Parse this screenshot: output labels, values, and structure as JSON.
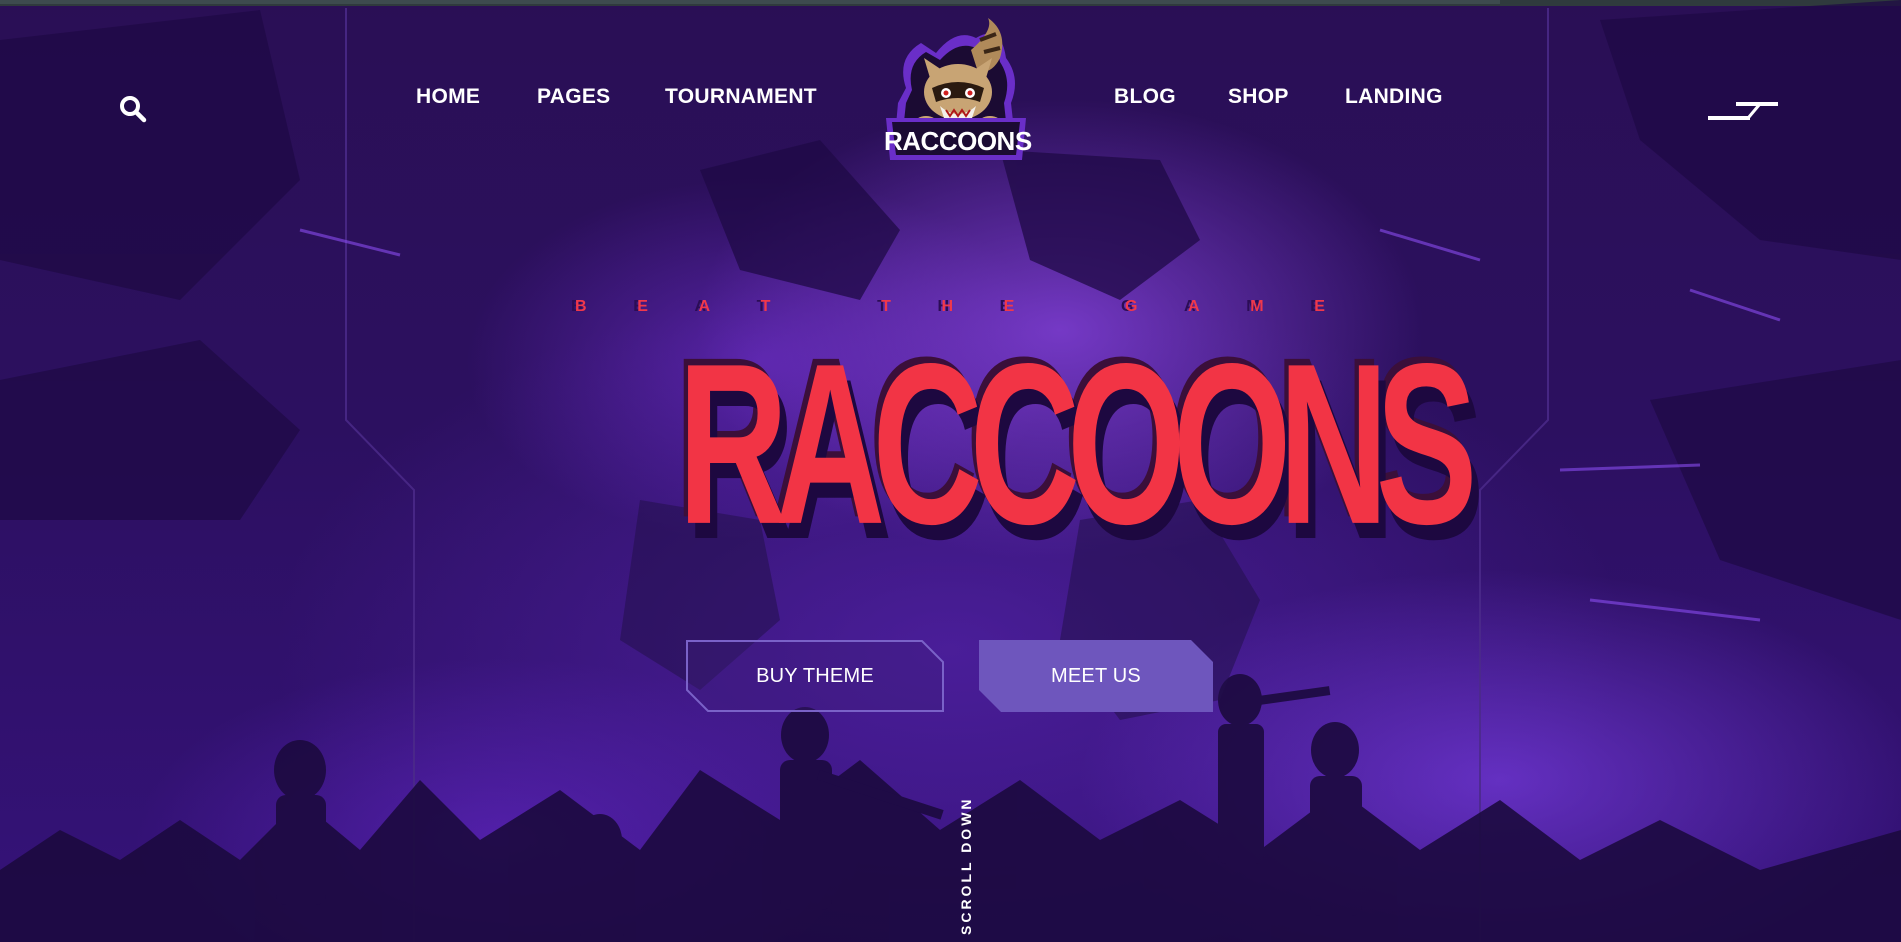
{
  "nav": {
    "left": [
      "HOME",
      "PAGES",
      "TOURNAMENT"
    ],
    "right": [
      "BLOG",
      "SHOP",
      "LANDING"
    ]
  },
  "brand": {
    "logo_text": "RACCOONS"
  },
  "hero": {
    "tagline": [
      "B",
      "E",
      "A",
      "T",
      "T",
      "H",
      "E",
      "G",
      "A",
      "M",
      "E"
    ],
    "title": "RACCOONS",
    "buy_button": "BUY THEME",
    "meet_button": "MEET US",
    "scroll_label": "SCROLL DOWN"
  },
  "colors": {
    "accent_red": "#f23445",
    "button_purple": "#6e56bd",
    "background_purple": "#2c1060"
  },
  "icons": {
    "search": "search-icon",
    "menu": "menu-icon"
  }
}
